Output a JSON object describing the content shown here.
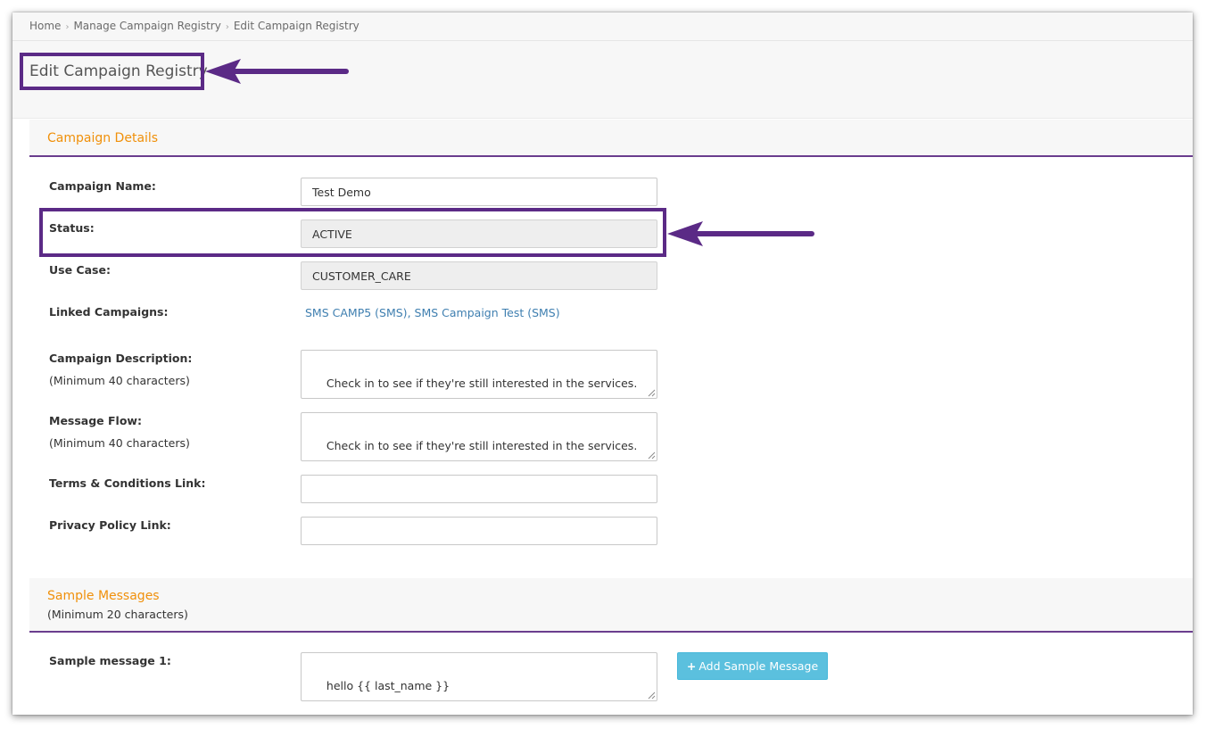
{
  "breadcrumb": {
    "items": [
      "Home",
      "Manage Campaign Registry",
      "Edit Campaign Registry"
    ],
    "separator": "›"
  },
  "page": {
    "title": "Edit Campaign Registry"
  },
  "campaign_details": {
    "section_title": "Campaign Details",
    "fields": {
      "campaign_name": {
        "label": "Campaign Name:",
        "value": "Test Demo"
      },
      "status": {
        "label": "Status:",
        "value": "ACTIVE"
      },
      "use_case": {
        "label": "Use Case:",
        "value": "CUSTOMER_CARE"
      },
      "linked_campaigns": {
        "label": "Linked Campaigns:",
        "links": [
          "SMS CAMP5 (SMS)",
          "SMS Campaign Test (SMS)"
        ],
        "separator": ", "
      },
      "campaign_description": {
        "label": "Campaign Description:",
        "note": "(Minimum 40 characters)",
        "value": "Check in to see if they're still interested in the services."
      },
      "message_flow": {
        "label": "Message Flow:",
        "note": "(Minimum 40 characters)",
        "value": "Check in to see if they're still interested in the services."
      },
      "terms_link": {
        "label": "Terms & Conditions Link:",
        "value": ""
      },
      "privacy_link": {
        "label": "Privacy Policy Link:",
        "value": ""
      }
    }
  },
  "sample_messages": {
    "section_title": "Sample Messages",
    "note": "(Minimum 20 characters)",
    "items": [
      {
        "label": "Sample message 1:",
        "value": "hello {{ last_name }}\n\nare you sure you dont want to buy anything"
      }
    ],
    "add_button": {
      "label": "Add Sample Message",
      "icon": "plus-icon"
    }
  },
  "colors": {
    "annotation": "#5b2a86",
    "section_title": "#f0900a",
    "section_rule": "#6a3d8e",
    "link": "#3f7fb0",
    "button": "#5bc0de"
  }
}
